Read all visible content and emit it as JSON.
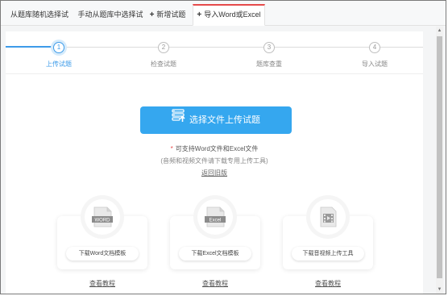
{
  "tabs": [
    {
      "label": "从题库随机选择试题"
    },
    {
      "label": "手动从题库中选择试题"
    },
    {
      "label": "新增试题"
    },
    {
      "label": "导入Word或Excel"
    }
  ],
  "steps": [
    {
      "number": "1",
      "label": "上传试题"
    },
    {
      "number": "2",
      "label": "检查试题"
    },
    {
      "number": "3",
      "label": "题库查重"
    },
    {
      "number": "4",
      "label": "导入试题"
    }
  ],
  "upload": {
    "label": "选择文件上传试题"
  },
  "support_text": "可支持Word文件和Excel文件",
  "note_text": "(音频和视频文件请下载专用上传工具)",
  "back_link": "返回旧版",
  "templates": [
    {
      "icon_label": "WORD",
      "button": "下载Word文档模板",
      "tutorial": "查看教程"
    },
    {
      "icon_label": "Excel",
      "button": "下载Excel文档模板",
      "tutorial": "查看教程"
    },
    {
      "icon_label": "",
      "button": "下载音视频上传工具",
      "tutorial": "查看教程"
    }
  ],
  "colors": {
    "accent": "#35a7ef",
    "active_tab": "#e64b4b"
  }
}
